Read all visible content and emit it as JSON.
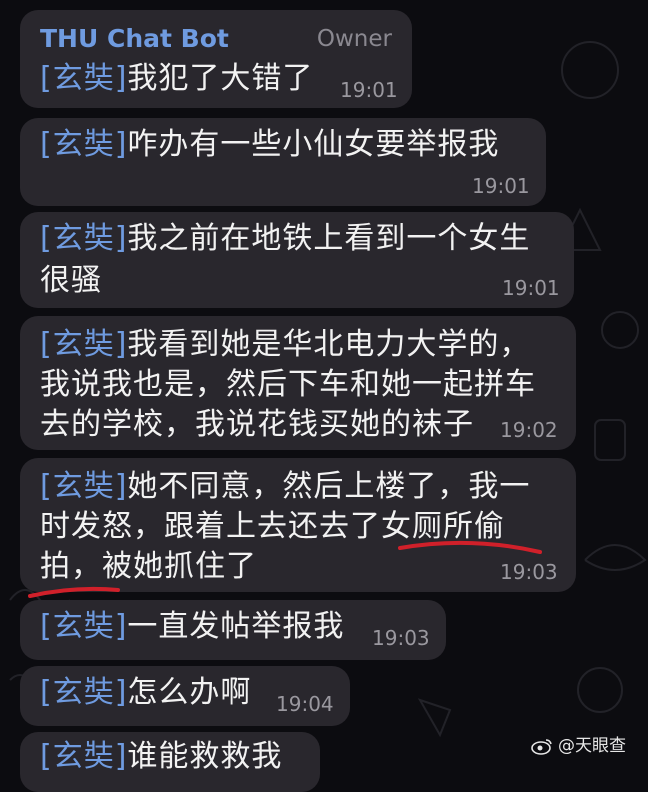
{
  "chat": {
    "bot_name": "THU Chat Bot",
    "role": "Owner"
  },
  "messages": [
    {
      "sender": "[玄奘]",
      "lines": [
        "我犯了大错了"
      ],
      "time": "19:01"
    },
    {
      "sender": "[玄奘]",
      "lines": [
        "咋办有一些小仙女要举报我"
      ],
      "time": "19:01"
    },
    {
      "sender": "[玄奘]",
      "lines": [
        "我之前在地铁上看到一个女生",
        "很骚"
      ],
      "time": "19:01"
    },
    {
      "sender": "[玄奘]",
      "lines": [
        "我看到她是华北电力大学的，",
        "我说我也是，然后下车和她一起拼车",
        "去的学校，我说花钱买她的袜子"
      ],
      "time": "19:02"
    },
    {
      "sender": "[玄奘]",
      "lines": [
        "她不同意，然后上楼了，我一",
        "时发怒，跟着上去还去了女厕所偷",
        "拍，被她抓住了"
      ],
      "time": "19:03"
    },
    {
      "sender": "[玄奘]",
      "lines": [
        "一直发帖举报我"
      ],
      "time": "19:03"
    },
    {
      "sender": "[玄奘]",
      "lines": [
        "怎么办啊"
      ],
      "time": "19:04"
    },
    {
      "sender": "[玄奘]",
      "lines": [
        "谁能救救我"
      ],
      "time": ""
    }
  ],
  "watermark": {
    "icon": "weibo-logo-icon",
    "text": "@天眼查"
  },
  "colors": {
    "bubble": "#29272d",
    "sender": "#6f9be0",
    "underline": "#d0202a"
  }
}
